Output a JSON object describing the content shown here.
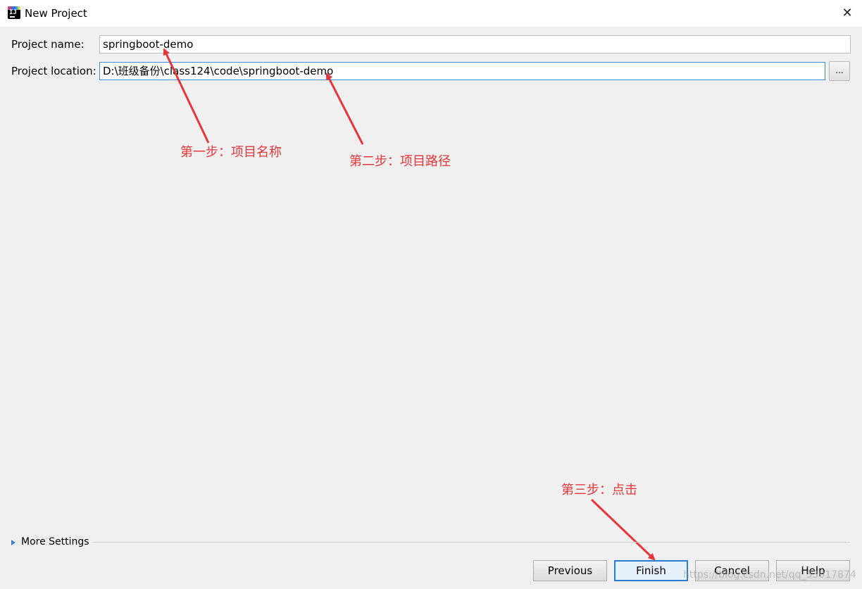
{
  "window": {
    "title": "New Project",
    "close_icon": "close-icon",
    "app_icon": "intellij-idea-icon",
    "app_icon_glyph": "IJ"
  },
  "form": {
    "name_label": "Project name:",
    "name_value": "springboot-demo",
    "location_label": "Project location:",
    "location_value": "D:\\班级备份\\class124\\code\\springboot-demo",
    "browse_label": "..."
  },
  "annotations": {
    "color": "#e5363a",
    "step1": "第一步：项目名称",
    "step2": "第二步：项目路径",
    "step3": "第三步：点击"
  },
  "more_settings": {
    "label": "More Settings"
  },
  "buttons": {
    "previous": "Previous",
    "finish": "Finish",
    "cancel": "Cancel",
    "help": "Help"
  },
  "watermark": "https://blog.csdn.net/qq_33017874"
}
